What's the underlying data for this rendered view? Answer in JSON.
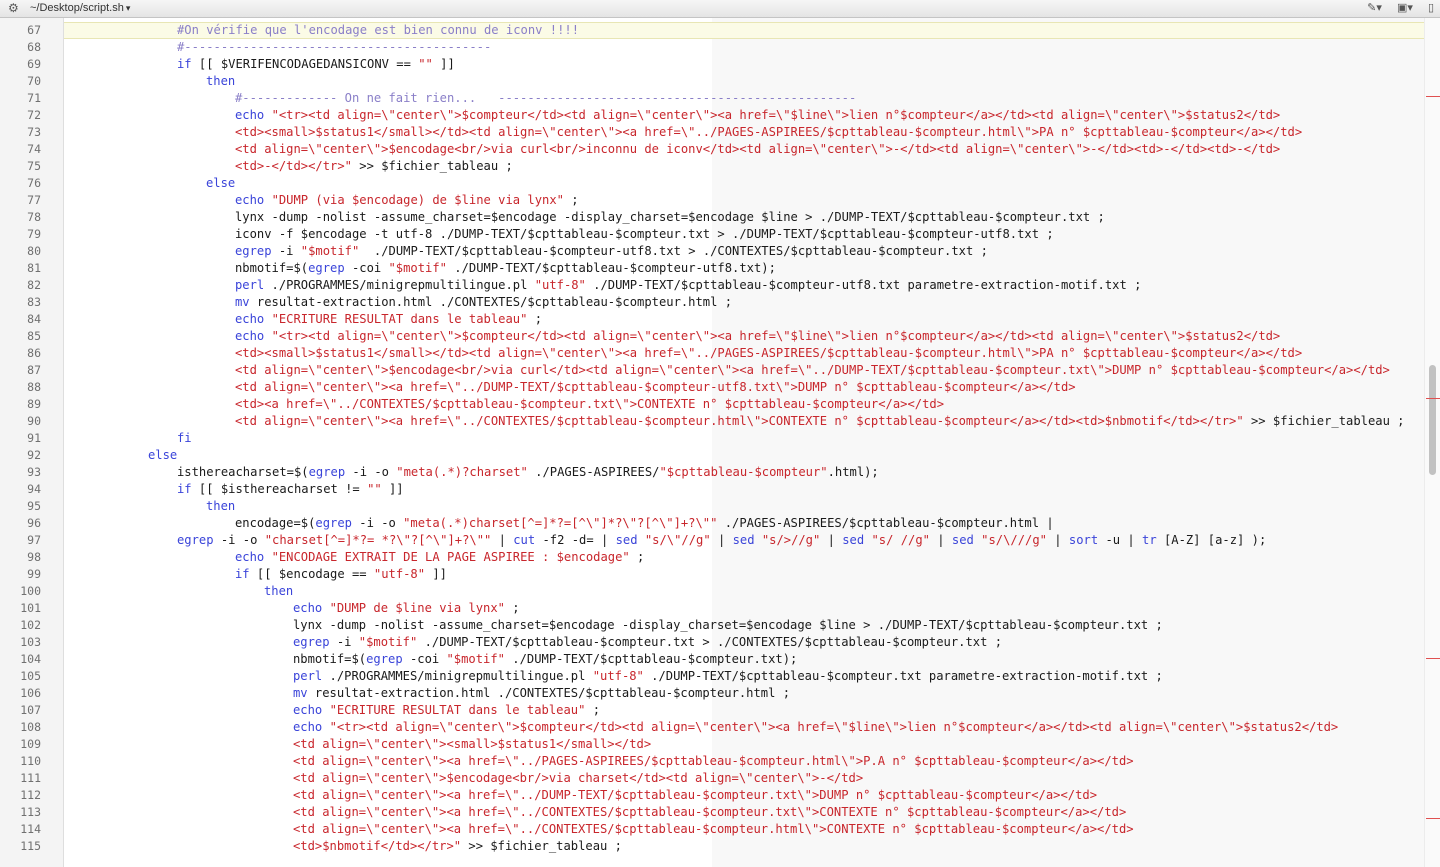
{
  "window": {
    "file_path": "~/Desktop/script.sh"
  },
  "icons": {
    "settings": "gear-icon",
    "path_dropdown": "chevron-down-icon",
    "edit": "pencil-icon",
    "layout": "window-layout-icon",
    "document": "document-icon"
  },
  "colors": {
    "keyword": "#3a44d9",
    "string": "#c8262c",
    "comment": "#8a7fc8",
    "text": "#1a1a1a",
    "current_line": "#fbfbe6"
  },
  "editor": {
    "current_line": 67,
    "lines": [
      {
        "n": "67",
        "indent": 4,
        "tokens": [
          {
            "t": "cm",
            "v": "#On vérifie que l'encodage est bien connu de iconv !!!!"
          }
        ]
      },
      {
        "n": "68",
        "indent": 4,
        "tokens": [
          {
            "t": "cm",
            "v": "#------------------------------------------"
          }
        ]
      },
      {
        "n": "69",
        "indent": 4,
        "tokens": [
          {
            "t": "kw",
            "v": "if"
          },
          {
            "t": "vr",
            "v": " [[ $VERIFENCODAGEDANSICONV == "
          },
          {
            "t": "st",
            "v": "\"\""
          },
          {
            "t": "vr",
            "v": " ]]"
          }
        ]
      },
      {
        "n": "70",
        "indent": 5,
        "tokens": [
          {
            "t": "kw",
            "v": "then"
          }
        ]
      },
      {
        "n": "71",
        "indent": 6,
        "tokens": [
          {
            "t": "cm",
            "v": "#------------- On ne fait rien...   -------------------------------------------------"
          }
        ]
      },
      {
        "n": "72",
        "indent": 6,
        "tokens": [
          {
            "t": "kw",
            "v": "echo"
          },
          {
            "t": "vr",
            "v": " "
          },
          {
            "t": "st",
            "v": "\"<tr><td align=\\\"center\\\">$compteur</td><td align=\\\"center\\\"><a href=\\\"$line\\\">lien n°$compteur</a></td><td align=\\\"center\\\">$status2</td>"
          }
        ]
      },
      {
        "n": "73",
        "indent": 6,
        "tokens": [
          {
            "t": "st",
            "v": "<td><small>$status1</small></td><td align=\\\"center\\\"><a href=\\\"../PAGES-ASPIREES/$cpttableau-$compteur.html\\\">PA n° $cpttableau-$compteur</a></td>"
          }
        ]
      },
      {
        "n": "74",
        "indent": 6,
        "tokens": [
          {
            "t": "st",
            "v": "<td align=\\\"center\\\">$encodage<br/>via curl<br/>inconnu de iconv</td><td align=\\\"center\\\">-</td><td align=\\\"center\\\">-</td><td>-</td><td>-</td>"
          }
        ]
      },
      {
        "n": "75",
        "indent": 6,
        "tokens": [
          {
            "t": "st",
            "v": "<td>-</td></tr>\""
          },
          {
            "t": "vr",
            "v": " >> $fichier_tableau ;"
          }
        ]
      },
      {
        "n": "76",
        "indent": 5,
        "tokens": [
          {
            "t": "kw",
            "v": "else"
          }
        ]
      },
      {
        "n": "77",
        "indent": 6,
        "tokens": [
          {
            "t": "kw",
            "v": "echo"
          },
          {
            "t": "vr",
            "v": " "
          },
          {
            "t": "st",
            "v": "\"DUMP (via $encodage) de $line via lynx\""
          },
          {
            "t": "vr",
            "v": " ;"
          }
        ]
      },
      {
        "n": "78",
        "indent": 6,
        "tokens": [
          {
            "t": "vr",
            "v": "lynx -dump -nolist -assume_charset=$encodage -display_charset=$encodage $line > ./DUMP-TEXT/$cpttableau-$compteur.txt ;"
          }
        ]
      },
      {
        "n": "79",
        "indent": 6,
        "tokens": [
          {
            "t": "vr",
            "v": "iconv -f $encodage -t utf-8 ./DUMP-TEXT/$cpttableau-$compteur.txt > ./DUMP-TEXT/$cpttableau-$compteur-utf8.txt ;"
          }
        ]
      },
      {
        "n": "80",
        "indent": 6,
        "tokens": [
          {
            "t": "kw",
            "v": "egrep"
          },
          {
            "t": "vr",
            "v": " -i "
          },
          {
            "t": "st",
            "v": "\"$motif\""
          },
          {
            "t": "vr",
            "v": "  ./DUMP-TEXT/$cpttableau-$compteur-utf8.txt > ./CONTEXTES/$cpttableau-$compteur.txt ;"
          }
        ]
      },
      {
        "n": "81",
        "indent": 6,
        "tokens": [
          {
            "t": "vr",
            "v": "nbmotif=$("
          },
          {
            "t": "kw",
            "v": "egrep"
          },
          {
            "t": "vr",
            "v": " -coi "
          },
          {
            "t": "st",
            "v": "\"$motif\""
          },
          {
            "t": "vr",
            "v": " ./DUMP-TEXT/$cpttableau-$compteur-utf8.txt);"
          }
        ]
      },
      {
        "n": "82",
        "indent": 6,
        "tokens": [
          {
            "t": "kw",
            "v": "perl"
          },
          {
            "t": "vr",
            "v": " ./PROGRAMMES/minigrepmultilingue.pl "
          },
          {
            "t": "st",
            "v": "\"utf-8\""
          },
          {
            "t": "vr",
            "v": " ./DUMP-TEXT/$cpttableau-$compteur-utf8.txt parametre-extraction-motif.txt ;"
          }
        ]
      },
      {
        "n": "83",
        "indent": 6,
        "tokens": [
          {
            "t": "kw",
            "v": "mv"
          },
          {
            "t": "vr",
            "v": " resultat-extraction.html ./CONTEXTES/$cpttableau-$compteur.html ;"
          }
        ]
      },
      {
        "n": "84",
        "indent": 6,
        "tokens": [
          {
            "t": "kw",
            "v": "echo"
          },
          {
            "t": "vr",
            "v": " "
          },
          {
            "t": "st",
            "v": "\"ECRITURE RESULTAT dans le tableau\""
          },
          {
            "t": "vr",
            "v": " ;"
          }
        ]
      },
      {
        "n": "85",
        "indent": 6,
        "tokens": [
          {
            "t": "kw",
            "v": "echo"
          },
          {
            "t": "vr",
            "v": " "
          },
          {
            "t": "st",
            "v": "\"<tr><td align=\\\"center\\\">$compteur</td><td align=\\\"center\\\"><a href=\\\"$line\\\">lien n°$compteur</a></td><td align=\\\"center\\\">$status2</td>"
          }
        ]
      },
      {
        "n": "86",
        "indent": 6,
        "tokens": [
          {
            "t": "st",
            "v": "<td><small>$status1</small></td><td align=\\\"center\\\"><a href=\\\"../PAGES-ASPIREES/$cpttableau-$compteur.html\\\">PA n° $cpttableau-$compteur</a></td>"
          }
        ]
      },
      {
        "n": "87",
        "indent": 6,
        "tokens": [
          {
            "t": "st",
            "v": "<td align=\\\"center\\\">$encodage<br/>via curl</td><td align=\\\"center\\\"><a href=\\\"../DUMP-TEXT/$cpttableau-$compteur.txt\\\">DUMP n° $cpttableau-$compteur</a></td>"
          }
        ]
      },
      {
        "n": "88",
        "indent": 6,
        "tokens": [
          {
            "t": "st",
            "v": "<td align=\\\"center\\\"><a href=\\\"../DUMP-TEXT/$cpttableau-$compteur-utf8.txt\\\">DUMP n° $cpttableau-$compteur</a></td>"
          }
        ]
      },
      {
        "n": "89",
        "indent": 6,
        "tokens": [
          {
            "t": "st",
            "v": "<td><a href=\\\"../CONTEXTES/$cpttableau-$compteur.txt\\\">CONTEXTE n° $cpttableau-$compteur</a></td>"
          }
        ]
      },
      {
        "n": "90",
        "indent": 6,
        "tokens": [
          {
            "t": "st",
            "v": "<td align=\\\"center\\\"><a href=\\\"../CONTEXTES/$cpttableau-$compteur.html\\\">CONTEXTE n° $cpttableau-$compteur</a></td><td>$nbmotif</td></tr>\""
          },
          {
            "t": "vr",
            "v": " >> $fichier_tableau ;"
          }
        ]
      },
      {
        "n": "91",
        "indent": 4,
        "tokens": [
          {
            "t": "kw",
            "v": "fi"
          }
        ]
      },
      {
        "n": "92",
        "indent": 3,
        "tokens": [
          {
            "t": "kw",
            "v": "else"
          }
        ]
      },
      {
        "n": "93",
        "indent": 4,
        "tokens": [
          {
            "t": "vr",
            "v": "isthereacharset=$("
          },
          {
            "t": "kw",
            "v": "egrep"
          },
          {
            "t": "vr",
            "v": " -i -o "
          },
          {
            "t": "st",
            "v": "\"meta(.*)?charset\""
          },
          {
            "t": "vr",
            "v": " ./PAGES-ASPIREES/"
          },
          {
            "t": "st",
            "v": "\"$cpttableau-$compteur\""
          },
          {
            "t": "vr",
            "v": ".html);"
          }
        ]
      },
      {
        "n": "94",
        "indent": 4,
        "tokens": [
          {
            "t": "kw",
            "v": "if"
          },
          {
            "t": "vr",
            "v": " [[ $isthereacharset != "
          },
          {
            "t": "st",
            "v": "\"\""
          },
          {
            "t": "vr",
            "v": " ]]"
          }
        ]
      },
      {
        "n": "95",
        "indent": 5,
        "tokens": [
          {
            "t": "kw",
            "v": "then"
          }
        ]
      },
      {
        "n": "96",
        "indent": 6,
        "tokens": [
          {
            "t": "vr",
            "v": "encodage=$("
          },
          {
            "t": "kw",
            "v": "egrep"
          },
          {
            "t": "vr",
            "v": " -i -o "
          },
          {
            "t": "st",
            "v": "\"meta(.*)charset[^=]*?=[^\\\"]*?\\\"?[^\\\"]+?\\\"\""
          },
          {
            "t": "vr",
            "v": " ./PAGES-ASPIREES/$cpttableau-$compteur.html |"
          }
        ]
      },
      {
        "n": "97",
        "indent": 4,
        "tokens": [
          {
            "t": "kw",
            "v": "egrep"
          },
          {
            "t": "vr",
            "v": " -i -o "
          },
          {
            "t": "st",
            "v": "\"charset[^=]*?= *?\\\"?[^\\\"]+?\\\"\""
          },
          {
            "t": "vr",
            "v": " | "
          },
          {
            "t": "kw",
            "v": "cut"
          },
          {
            "t": "vr",
            "v": " -f2 -d= | "
          },
          {
            "t": "kw",
            "v": "sed"
          },
          {
            "t": "vr",
            "v": " "
          },
          {
            "t": "st",
            "v": "\"s/\\\"//g\""
          },
          {
            "t": "vr",
            "v": " | "
          },
          {
            "t": "kw",
            "v": "sed"
          },
          {
            "t": "vr",
            "v": " "
          },
          {
            "t": "st",
            "v": "\"s/>//g\""
          },
          {
            "t": "vr",
            "v": " | "
          },
          {
            "t": "kw",
            "v": "sed"
          },
          {
            "t": "vr",
            "v": " "
          },
          {
            "t": "st",
            "v": "\"s/ //g\""
          },
          {
            "t": "vr",
            "v": " | "
          },
          {
            "t": "kw",
            "v": "sed"
          },
          {
            "t": "vr",
            "v": " "
          },
          {
            "t": "st",
            "v": "\"s/\\///g\""
          },
          {
            "t": "vr",
            "v": " | "
          },
          {
            "t": "kw",
            "v": "sort"
          },
          {
            "t": "vr",
            "v": " -u | "
          },
          {
            "t": "kw",
            "v": "tr"
          },
          {
            "t": "vr",
            "v": " [A-Z] [a-z] );"
          }
        ]
      },
      {
        "n": "98",
        "indent": 6,
        "tokens": [
          {
            "t": "kw",
            "v": "echo"
          },
          {
            "t": "vr",
            "v": " "
          },
          {
            "t": "st",
            "v": "\"ENCODAGE EXTRAIT DE LA PAGE ASPIREE : $encodage\""
          },
          {
            "t": "vr",
            "v": " ;"
          }
        ]
      },
      {
        "n": "99",
        "indent": 6,
        "tokens": [
          {
            "t": "kw",
            "v": "if"
          },
          {
            "t": "vr",
            "v": " [[ $encodage == "
          },
          {
            "t": "st",
            "v": "\"utf-8\""
          },
          {
            "t": "vr",
            "v": " ]]"
          }
        ]
      },
      {
        "n": "100",
        "indent": 7,
        "tokens": [
          {
            "t": "kw",
            "v": "then"
          }
        ]
      },
      {
        "n": "101",
        "indent": 8,
        "tokens": [
          {
            "t": "kw",
            "v": "echo"
          },
          {
            "t": "vr",
            "v": " "
          },
          {
            "t": "st",
            "v": "\"DUMP de $line via lynx\""
          },
          {
            "t": "vr",
            "v": " ;"
          }
        ]
      },
      {
        "n": "102",
        "indent": 8,
        "tokens": [
          {
            "t": "vr",
            "v": "lynx -dump -nolist -assume_charset=$encodage -display_charset=$encodage $line > ./DUMP-TEXT/$cpttableau-$compteur.txt ;"
          }
        ]
      },
      {
        "n": "103",
        "indent": 8,
        "tokens": [
          {
            "t": "kw",
            "v": "egrep"
          },
          {
            "t": "vr",
            "v": " -i "
          },
          {
            "t": "st",
            "v": "\"$motif\""
          },
          {
            "t": "vr",
            "v": " ./DUMP-TEXT/$cpttableau-$compteur.txt > ./CONTEXTES/$cpttableau-$compteur.txt ;"
          }
        ]
      },
      {
        "n": "104",
        "indent": 8,
        "tokens": [
          {
            "t": "vr",
            "v": "nbmotif=$("
          },
          {
            "t": "kw",
            "v": "egrep"
          },
          {
            "t": "vr",
            "v": " -coi "
          },
          {
            "t": "st",
            "v": "\"$motif\""
          },
          {
            "t": "vr",
            "v": " ./DUMP-TEXT/$cpttableau-$compteur.txt);"
          }
        ]
      },
      {
        "n": "105",
        "indent": 8,
        "tokens": [
          {
            "t": "kw",
            "v": "perl"
          },
          {
            "t": "vr",
            "v": " ./PROGRAMMES/minigrepmultilingue.pl "
          },
          {
            "t": "st",
            "v": "\"utf-8\""
          },
          {
            "t": "vr",
            "v": " ./DUMP-TEXT/$cpttableau-$compteur.txt parametre-extraction-motif.txt ;"
          }
        ]
      },
      {
        "n": "106",
        "indent": 8,
        "tokens": [
          {
            "t": "kw",
            "v": "mv"
          },
          {
            "t": "vr",
            "v": " resultat-extraction.html ./CONTEXTES/$cpttableau-$compteur.html ;"
          }
        ]
      },
      {
        "n": "107",
        "indent": 8,
        "tokens": [
          {
            "t": "kw",
            "v": "echo"
          },
          {
            "t": "vr",
            "v": " "
          },
          {
            "t": "st",
            "v": "\"ECRITURE RESULTAT dans le tableau\""
          },
          {
            "t": "vr",
            "v": " ;"
          }
        ]
      },
      {
        "n": "108",
        "indent": 8,
        "tokens": [
          {
            "t": "kw",
            "v": "echo"
          },
          {
            "t": "vr",
            "v": " "
          },
          {
            "t": "st",
            "v": "\"<tr><td align=\\\"center\\\">$compteur</td><td align=\\\"center\\\"><a href=\\\"$line\\\">lien n°$compteur</a></td><td align=\\\"center\\\">$status2</td>"
          }
        ]
      },
      {
        "n": "109",
        "indent": 8,
        "tokens": [
          {
            "t": "st",
            "v": "<td align=\\\"center\\\"><small>$status1</small></td>"
          }
        ]
      },
      {
        "n": "110",
        "indent": 8,
        "tokens": [
          {
            "t": "st",
            "v": "<td align=\\\"center\\\"><a href=\\\"../PAGES-ASPIREES/$cpttableau-$compteur.html\\\">P.A n° $cpttableau-$compteur</a></td>"
          }
        ]
      },
      {
        "n": "111",
        "indent": 8,
        "tokens": [
          {
            "t": "st",
            "v": "<td align=\\\"center\\\">$encodage<br/>via charset</td><td align=\\\"center\\\">-</td>"
          }
        ]
      },
      {
        "n": "112",
        "indent": 8,
        "tokens": [
          {
            "t": "st",
            "v": "<td align=\\\"center\\\"><a href=\\\"../DUMP-TEXT/$cpttableau-$compteur.txt\\\">DUMP n° $cpttableau-$compteur</a></td>"
          }
        ]
      },
      {
        "n": "113",
        "indent": 8,
        "tokens": [
          {
            "t": "st",
            "v": "<td align=\\\"center\\\"><a href=\\\"../CONTEXTES/$cpttableau-$compteur.txt\\\">CONTEXTE n° $cpttableau-$compteur</a></td>"
          }
        ]
      },
      {
        "n": "114",
        "indent": 8,
        "tokens": [
          {
            "t": "st",
            "v": "<td align=\\\"center\\\"><a href=\\\"../CONTEXTES/$cpttableau-$compteur.html\\\">CONTEXTE n° $cpttableau-$compteur</a></td>"
          }
        ]
      },
      {
        "n": "115",
        "indent": 8,
        "tokens": [
          {
            "t": "st",
            "v": "<td>$nbmotif</td></tr>\""
          },
          {
            "t": "vr",
            "v": " >> $fichier_tableau ;"
          }
        ]
      }
    ]
  }
}
